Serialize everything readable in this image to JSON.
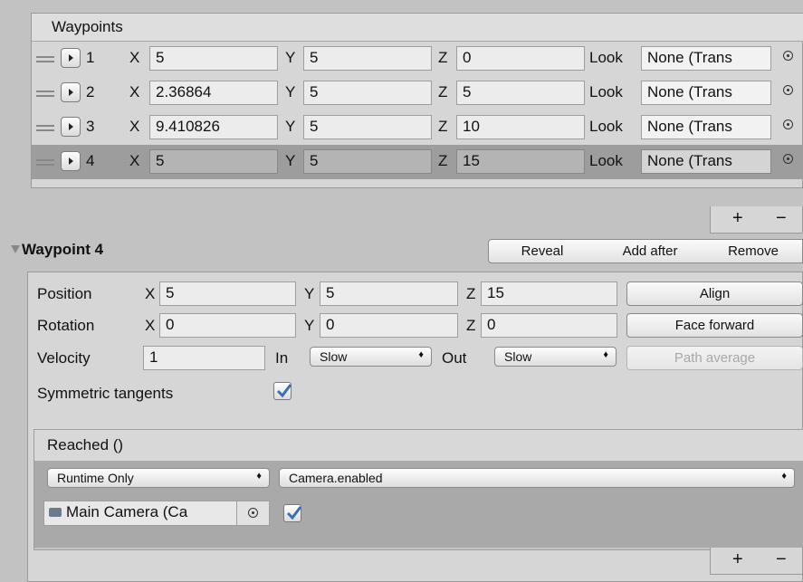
{
  "list": {
    "header": "Waypoints",
    "rows": [
      {
        "index": "1",
        "x_label": "X",
        "x": "5",
        "y_label": "Y",
        "y": "5",
        "z_label": "Z",
        "z": "0",
        "look_label": "Look",
        "look": "None (Trans"
      },
      {
        "index": "2",
        "x_label": "X",
        "x": "2.36864",
        "y_label": "Y",
        "y": "5",
        "z_label": "Z",
        "z": "5",
        "look_label": "Look",
        "look": "None (Trans"
      },
      {
        "index": "3",
        "x_label": "X",
        "x": "9.410826",
        "y_label": "Y",
        "y": "5",
        "z_label": "Z",
        "z": "10",
        "look_label": "Look",
        "look": "None (Trans"
      },
      {
        "index": "4",
        "x_label": "X",
        "x": "5",
        "y_label": "Y",
        "y": "5",
        "z_label": "Z",
        "z": "15",
        "look_label": "Look",
        "look": "None (Trans"
      }
    ],
    "selected_index": 3,
    "add_symbol": "+",
    "remove_symbol": "−"
  },
  "waypoint": {
    "title": "Waypoint 4",
    "buttons": {
      "reveal": "Reveal",
      "add_after": "Add after",
      "remove": "Remove"
    },
    "position": {
      "label": "Position",
      "x_label": "X",
      "x": "5",
      "y_label": "Y",
      "y": "5",
      "z_label": "Z",
      "z": "15",
      "button": "Align"
    },
    "rotation": {
      "label": "Rotation",
      "x_label": "X",
      "x": "0",
      "y_label": "Y",
      "y": "0",
      "z_label": "Z",
      "z": "0",
      "button": "Face forward"
    },
    "velocity": {
      "label": "Velocity",
      "value": "1",
      "in_label": "In",
      "in_value": "Slow",
      "out_label": "Out",
      "out_value": "Slow",
      "button": "Path average"
    },
    "symmetric": {
      "label": "Symmetric tangents",
      "checked": true
    }
  },
  "event": {
    "title": "Reached ()",
    "mode": "Runtime Only",
    "function": "Camera.enabled",
    "target": "Main Camera (Ca",
    "arg_checked": true,
    "add_symbol": "+",
    "remove_symbol": "−"
  },
  "colors": {
    "check": "#3a6fb8",
    "panel": "#d6d6d6",
    "selected_row": "#9d9d9d"
  }
}
